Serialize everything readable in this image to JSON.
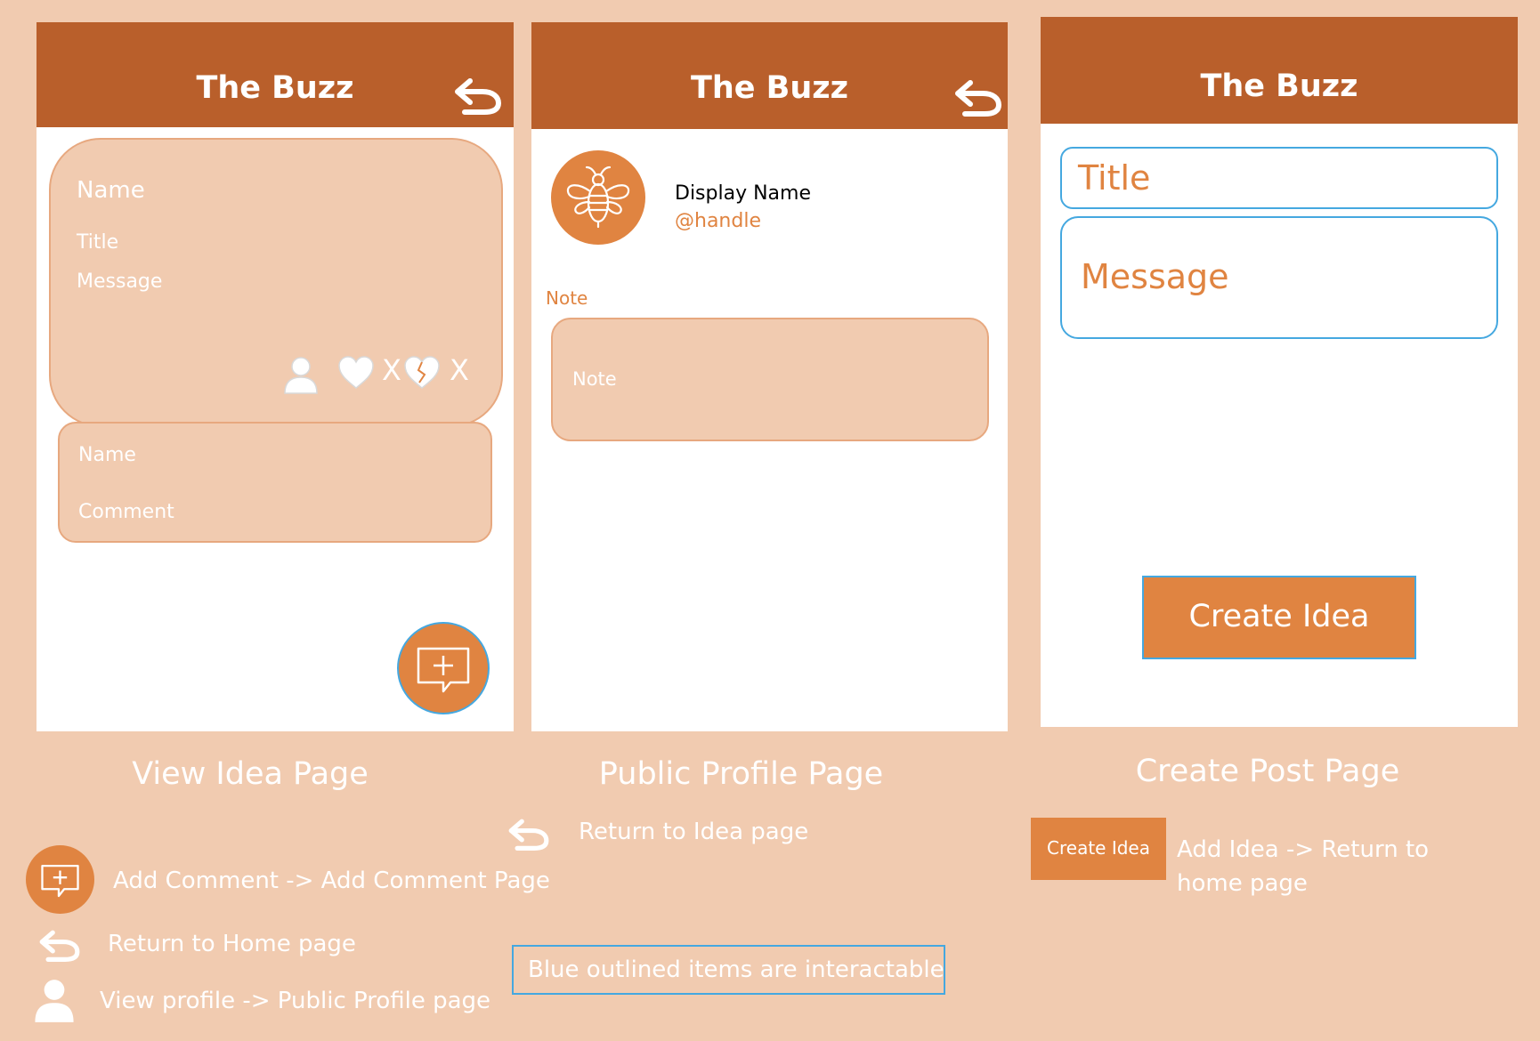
{
  "colors": {
    "background": "#F1CBB0",
    "header": "#B95F2B",
    "accent": "#E08441",
    "interactable_outline": "#45A8E0",
    "card_fill": "#F1CBB0",
    "card_border": "#E7A87F"
  },
  "view_idea": {
    "app_title": "The Buzz",
    "back_icon": "undo-arrow-icon",
    "post": {
      "name": "Name",
      "title": "Title",
      "message": "Message",
      "profile_icon": "person-icon",
      "like_icon": "heart-icon",
      "like_count": "X",
      "dislike_icon": "broken-heart-icon",
      "dislike_count": "X"
    },
    "comment": {
      "name": "Name",
      "comment": "Comment"
    },
    "fab_icon": "add-comment-icon",
    "caption": "View Idea Page"
  },
  "public_profile": {
    "app_title": "The Buzz",
    "back_icon": "undo-arrow-icon",
    "avatar_icon": "bee-icon",
    "display_name": "Display Name",
    "handle": "@handle",
    "note_label": "Note",
    "note_text": "Note",
    "caption": "Public Profile Page"
  },
  "create_post": {
    "app_title": "The Buzz",
    "title_placeholder": "Title",
    "message_placeholder": "Message",
    "create_button": "Create Idea",
    "caption": "Create Post Page"
  },
  "legend": {
    "add_comment": "Add Comment -> Add Comment Page",
    "return_home": "Return to Home page",
    "view_profile": "View profile -> Public Profile page",
    "return_idea": "Return to Idea page",
    "note": "Blue outlined items are interactable",
    "create_idea_label": "Create Idea",
    "create_idea_line1": "Add Idea -> Return to",
    "create_idea_line2": "home page"
  }
}
